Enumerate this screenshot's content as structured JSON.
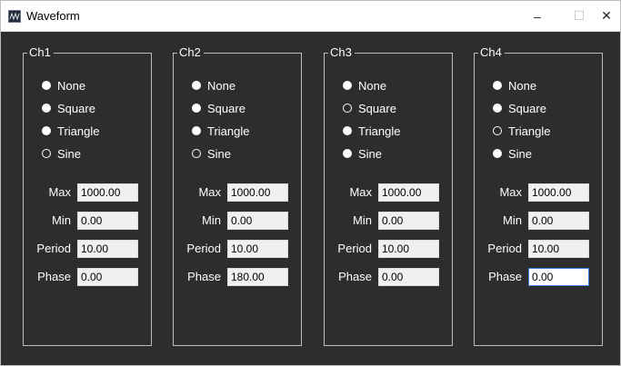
{
  "window": {
    "title": "Waveform"
  },
  "controls": {
    "minimize": "–",
    "maximize": "☐",
    "close": "✕"
  },
  "radio_labels": [
    "None",
    "Square",
    "Triangle",
    "Sine"
  ],
  "field_labels": [
    "Max",
    "Min",
    "Period",
    "Phase"
  ],
  "channels": [
    {
      "name": "Ch1",
      "selected": "Sine",
      "fields": {
        "max": "1000.00",
        "min": "0.00",
        "period": "10.00",
        "phase": "0.00"
      }
    },
    {
      "name": "Ch2",
      "selected": "Sine",
      "fields": {
        "max": "1000.00",
        "min": "0.00",
        "period": "10.00",
        "phase": "180.00"
      }
    },
    {
      "name": "Ch3",
      "selected": "Square",
      "fields": {
        "max": "1000.00",
        "min": "0.00",
        "period": "10.00",
        "phase": "0.00"
      }
    },
    {
      "name": "Ch4",
      "selected": "Triangle",
      "focused_field": "phase",
      "fields": {
        "max": "1000.00",
        "min": "0.00",
        "period": "10.00",
        "phase": "0.00"
      }
    }
  ],
  "colors": {
    "background": "#2d2d2d",
    "text": "#ffffff",
    "border": "#bdbdbd",
    "focus": "#3a7ad8"
  },
  "icons": [
    "waveform-app-icon",
    "minimize-icon",
    "maximize-icon",
    "close-icon"
  ]
}
